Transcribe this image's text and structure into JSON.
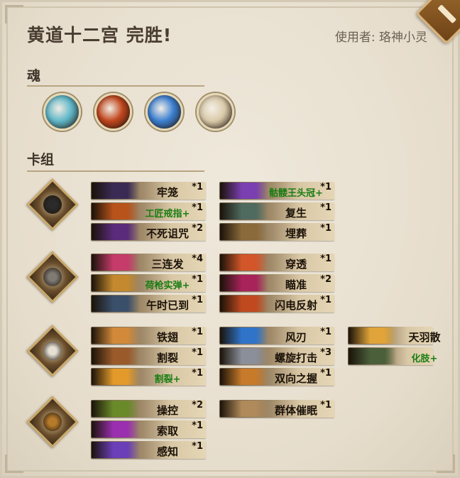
{
  "header": {
    "title": "黄道十二宫 完胜!",
    "user_label": "使用者:",
    "user_name": "珞神小灵"
  },
  "souls": {
    "title": "魂",
    "items": [
      {
        "icon": "stone-guardian-soul-icon",
        "color": "#5fb7c9"
      },
      {
        "icon": "fire-orb-soul-icon",
        "color": "#c0451d"
      },
      {
        "icon": "ice-wave-soul-icon",
        "color": "#3b7fd1"
      },
      {
        "icon": "eagle-soul-icon",
        "color": "#d9c9a8"
      }
    ]
  },
  "deck": {
    "title": "卡组",
    "groups": [
      {
        "hero": "skull-knight-hero-icon",
        "cards": [
          {
            "name": "牢笼",
            "count": "*1",
            "upgraded": false,
            "art": "#3a2b55"
          },
          {
            "name": "工匠戒指+",
            "count": "*1",
            "upgraded": true,
            "art": "#b8531b"
          },
          {
            "name": "不死诅咒",
            "count": "*2",
            "upgraded": false,
            "art": "#5a2b7a"
          },
          {
            "name": "骷髅王头冠+",
            "count": "*1",
            "upgraded": true,
            "art": "#7a3fb0"
          },
          {
            "name": "复生",
            "count": "*1",
            "upgraded": false,
            "art": "#4f6a5f"
          },
          {
            "name": "埋葬",
            "count": "*1",
            "upgraded": false,
            "art": "#8a6a3a"
          }
        ]
      },
      {
        "hero": "gunslinger-hero-icon",
        "cards": [
          {
            "name": "三连发",
            "count": "*4",
            "upgraded": false,
            "art": "#c53b6a"
          },
          {
            "name": "荷枪实弹+",
            "count": "*1",
            "upgraded": true,
            "art": "#c4892f"
          },
          {
            "name": "午时已到",
            "count": "*1",
            "upgraded": false,
            "art": "#3a4f6a"
          },
          {
            "name": "穿透",
            "count": "*1",
            "upgraded": false,
            "art": "#d3562a"
          },
          {
            "name": "瞄准",
            "count": "*2",
            "upgraded": false,
            "art": "#a8235a"
          },
          {
            "name": "闪电反射",
            "count": "*1",
            "upgraded": false,
            "art": "#c0491f"
          }
        ]
      },
      {
        "hero": "feather-warrior-hero-icon",
        "cards": [
          {
            "name": "铁翅",
            "count": "*1",
            "upgraded": false,
            "art": "#d28a3a"
          },
          {
            "name": "割裂",
            "count": "*1",
            "upgraded": false,
            "art": "#9a5a2a"
          },
          {
            "name": "割裂+",
            "count": "*1",
            "upgraded": true,
            "art": "#e39a2b"
          },
          {
            "name": "风刃",
            "count": "*1",
            "upgraded": false,
            "art": "#2f74c9"
          },
          {
            "name": "螺旋打击",
            "count": "*3",
            "upgraded": false,
            "art": "#8a8f9a"
          },
          {
            "name": "双向之握",
            "count": "*1",
            "upgraded": false,
            "art": "#c77a2a"
          },
          {
            "name": "天羽散",
            "count": "",
            "upgraded": false,
            "art": "#e0a43a"
          },
          {
            "name": "化肢+",
            "count": "",
            "upgraded": true,
            "art": "#4a5f3a"
          }
        ]
      },
      {
        "hero": "eye-amulet-hero-icon",
        "cards": [
          {
            "name": "操控",
            "count": "*2",
            "upgraded": false,
            "art": "#6a8a2a"
          },
          {
            "name": "索取",
            "count": "*1",
            "upgraded": false,
            "art": "#9a2fb0"
          },
          {
            "name": "感知",
            "count": "*1",
            "upgraded": false,
            "art": "#6a3fb8"
          },
          {
            "name": "群体催眠",
            "count": "*1",
            "upgraded": false,
            "art": "#b08a5a"
          }
        ]
      }
    ]
  }
}
